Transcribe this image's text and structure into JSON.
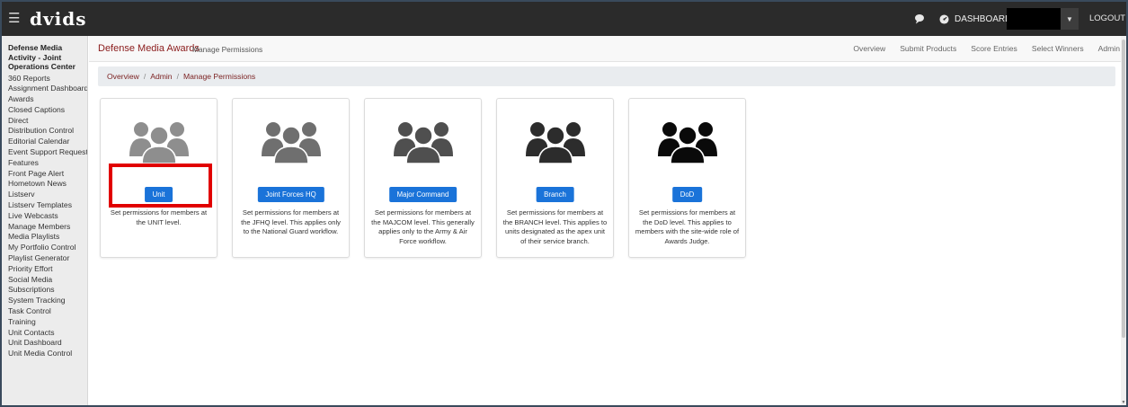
{
  "topbar": {
    "logo": "dvids",
    "dashboard_label": "DASHBOARD",
    "logout_label": "LOGOUT",
    "colors": {
      "bar": "#2b2b2b",
      "text": "#f0f0f0"
    }
  },
  "sidebar": {
    "org_name": "Defense Media Activity - Joint Operations Center",
    "items": [
      "360 Reports",
      "Assignment Dashboard",
      "Awards",
      "Closed Captions",
      "Direct",
      "Distribution Control",
      "Editorial Calendar",
      "Event Support Request",
      "Features",
      "Front Page Alert",
      "Hometown News",
      "Listserv",
      "Listserv Templates",
      "Live Webcasts",
      "Manage Members",
      "Media Playlists",
      "My Portfolio Control",
      "Playlist Generator",
      "Priority Effort",
      "Social Media",
      "Subscriptions",
      "System Tracking",
      "Task Control",
      "Training",
      "Unit Contacts",
      "Unit Dashboard",
      "Unit Media Control"
    ]
  },
  "header": {
    "brand": "Defense Media Awards",
    "subtitle": "Manage Permissions",
    "nav": [
      "Overview",
      "Submit Products",
      "Score Entries",
      "Select Winners",
      "Admin"
    ]
  },
  "breadcrumb": {
    "items": [
      "Overview",
      "Admin"
    ],
    "current": "Manage Permissions",
    "separator": "/"
  },
  "cards": [
    {
      "button": "Unit",
      "description": "Set permissions for members at the UNIT level.",
      "icon": "users-icon",
      "icon_color": "#8e8e8e"
    },
    {
      "button": "Joint Forces HQ",
      "description": "Set permissions for members at the JFHQ level. This applies only to the National Guard workflow.",
      "icon": "users-icon",
      "icon_color": "#6f6f6f"
    },
    {
      "button": "Major Command",
      "description": "Set permissions for members at the MAJCOM level. This generally applies only to the Army & Air Force workflow.",
      "icon": "users-icon",
      "icon_color": "#4f4f4f"
    },
    {
      "button": "Branch",
      "description": "Set permissions for members at the BRANCH level. This applies to units designated as the apex unit of their service branch.",
      "icon": "users-icon",
      "icon_color": "#2c2c2c"
    },
    {
      "button": "DoD",
      "description": "Set permissions for members at the DoD level. This applies to members with the site-wide role of Awards Judge.",
      "icon": "users-icon",
      "icon_color": "#0a0a0a"
    }
  ],
  "colors": {
    "accent": "#1a73d9",
    "brand": "#8a1b1b",
    "highlight": "#e10000"
  }
}
